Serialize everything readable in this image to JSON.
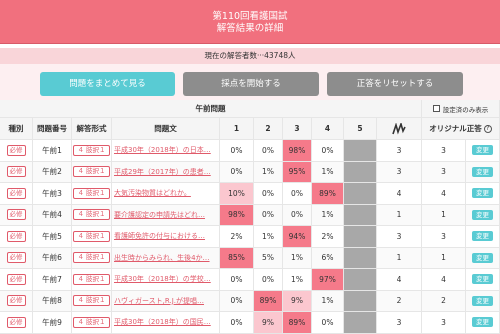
{
  "header": {
    "title_line1": "第110回看護国試",
    "title_line2": "解答結果の詳細"
  },
  "respondents": "現在の解答者数···43748人",
  "buttons": {
    "summary": "問題をまとめて見る",
    "start": "採点を開始する",
    "reset": "正答をリセットする"
  },
  "table_header": {
    "session": "午前問題",
    "show_setting_label": "設定済のみ表示",
    "columns": [
      "種別",
      "問題番号",
      "解答形式",
      "問題文",
      "1",
      "2",
      "3",
      "4",
      "5",
      "",
      "",
      "オリジナル正答"
    ],
    "chart_icon": "tally-chart-icon"
  },
  "rows": [
    {
      "kind": "必修",
      "num": "午前1",
      "type": "４ 肢択１",
      "text": "平成30年（2018年）の日本…",
      "p": [
        "0%",
        "0%",
        "98%",
        "0%"
      ],
      "hi": [
        false,
        false,
        true,
        false
      ],
      "mid": [
        false,
        false,
        false,
        false
      ],
      "ans": "3",
      "orig": "3",
      "action": "変更"
    },
    {
      "kind": "必修",
      "num": "午前2",
      "type": "４ 肢択１",
      "text": "平成29年（2017年）の患者…",
      "p": [
        "0%",
        "1%",
        "95%",
        "1%"
      ],
      "hi": [
        false,
        false,
        true,
        false
      ],
      "mid": [
        false,
        false,
        false,
        false
      ],
      "ans": "3",
      "orig": "3",
      "action": "変更"
    },
    {
      "kind": "必修",
      "num": "午前3",
      "type": "４ 肢択１",
      "text": "大気汚染物質はどれか。",
      "p": [
        "10%",
        "0%",
        "0%",
        "89%"
      ],
      "hi": [
        false,
        false,
        false,
        true
      ],
      "mid": [
        true,
        false,
        false,
        false
      ],
      "ans": "4",
      "orig": "4",
      "action": "変更"
    },
    {
      "kind": "必修",
      "num": "午前4",
      "type": "４ 肢択１",
      "text": "要介護認定の申請先はどれ…",
      "p": [
        "98%",
        "0%",
        "0%",
        "1%"
      ],
      "hi": [
        true,
        false,
        false,
        false
      ],
      "mid": [
        false,
        false,
        false,
        false
      ],
      "ans": "1",
      "orig": "1",
      "action": "変更"
    },
    {
      "kind": "必修",
      "num": "午前5",
      "type": "４ 肢択１",
      "text": "看護師免許の付与における…",
      "p": [
        "2%",
        "1%",
        "94%",
        "2%"
      ],
      "hi": [
        false,
        false,
        true,
        false
      ],
      "mid": [
        false,
        false,
        false,
        false
      ],
      "ans": "3",
      "orig": "3",
      "action": "変更"
    },
    {
      "kind": "必修",
      "num": "午前6",
      "type": "４ 肢択１",
      "text": "出生時からみられ、生後4か…",
      "p": [
        "85%",
        "5%",
        "1%",
        "6%"
      ],
      "hi": [
        true,
        false,
        false,
        false
      ],
      "mid": [
        false,
        false,
        false,
        false
      ],
      "ans": "1",
      "orig": "1",
      "action": "変更"
    },
    {
      "kind": "必修",
      "num": "午前7",
      "type": "４ 肢択１",
      "text": "平成30年（2018年）の学校…",
      "p": [
        "0%",
        "0%",
        "1%",
        "97%"
      ],
      "hi": [
        false,
        false,
        false,
        true
      ],
      "mid": [
        false,
        false,
        false,
        false
      ],
      "ans": "4",
      "orig": "4",
      "action": "変更"
    },
    {
      "kind": "必修",
      "num": "午前8",
      "type": "４ 肢択１",
      "text": "ハヴィガースト,R.J.が提唱…",
      "p": [
        "0%",
        "89%",
        "9%",
        "1%"
      ],
      "hi": [
        false,
        true,
        false,
        false
      ],
      "mid": [
        false,
        false,
        true,
        false
      ],
      "ans": "2",
      "orig": "2",
      "action": "変更"
    },
    {
      "kind": "必修",
      "num": "午前9",
      "type": "４ 肢択１",
      "text": "平成30年（2018年）の国民…",
      "p": [
        "0%",
        "9%",
        "89%",
        "0%"
      ],
      "hi": [
        false,
        false,
        true,
        false
      ],
      "mid": [
        false,
        true,
        false,
        false
      ],
      "ans": "3",
      "orig": "3",
      "action": "変更"
    }
  ]
}
